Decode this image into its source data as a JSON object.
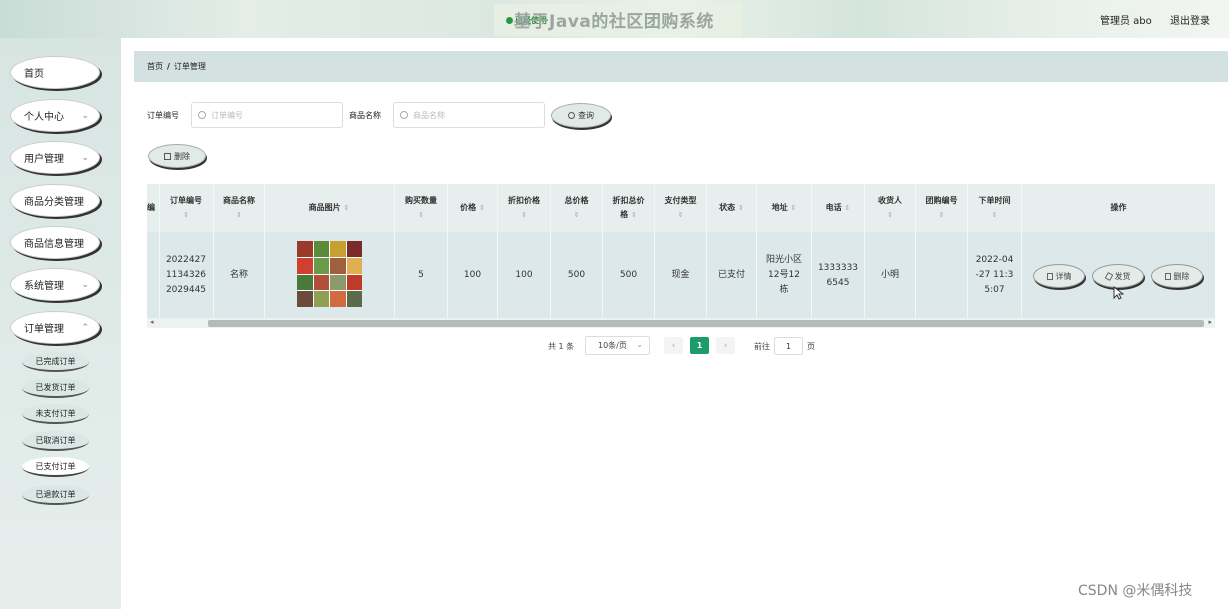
{
  "header": {
    "badge": "已经使用",
    "title": "基于Java的社区团购系统",
    "user": "管理员 abo",
    "logout": "退出登录"
  },
  "sidebar": {
    "items": [
      {
        "label": "首页",
        "chevron": false
      },
      {
        "label": "个人中心",
        "chevron": true
      },
      {
        "label": "用户管理",
        "chevron": true
      },
      {
        "label": "商品分类管理",
        "chevron": false
      },
      {
        "label": "商品信息管理",
        "chevron": false
      },
      {
        "label": "系统管理",
        "chevron": true
      },
      {
        "label": "订单管理",
        "chevron": true
      }
    ],
    "subitems": [
      "已完成订单",
      "已发货订单",
      "未支付订单",
      "已取消订单",
      "已支付订单",
      "已退款订单"
    ],
    "active_subitem": "已支付订单"
  },
  "breadcrumb": {
    "home": "首页",
    "separator": "/",
    "current": "订单管理"
  },
  "search": {
    "order_no_label": "订单编号",
    "order_no_placeholder": "订单编号",
    "product_name_label": "商品名称",
    "product_name_placeholder": "商品名称",
    "query_button": "查询",
    "delete_button": "删除"
  },
  "table": {
    "headers": {
      "cut": "编",
      "order_no": "订单编号",
      "product_name": "商品名称",
      "product_image": "商品图片",
      "quantity": "购买数量",
      "price": "价格",
      "discount_price": "折扣价格",
      "total_price": "总价格",
      "discount_total_line1": "折扣总价",
      "discount_total_line2": "格",
      "payment_type": "支付类型",
      "status": "状态",
      "address": "地址",
      "phone": "电话",
      "receiver": "收货人",
      "group_no": "团购编号",
      "order_time": "下单时间",
      "actions": "操作"
    },
    "sort_glyph": "⇕",
    "row": {
      "order_no_lines": [
        "2022427",
        "1134326",
        "2029445"
      ],
      "product_name": "名称",
      "quantity": "5",
      "price": "100",
      "discount_price": "100",
      "total_price": "500",
      "discount_total": "500",
      "payment_type": "现金",
      "status": "已支付",
      "address_lines": [
        "阳光小区",
        "12号12",
        "栋"
      ],
      "phone_lines": [
        "1333333",
        "6545"
      ],
      "receiver": "小明",
      "group_no": "",
      "order_time_lines": [
        "2022-04",
        "-27 11:3",
        "5:07"
      ],
      "btn_detail": "详情",
      "btn_ship": "发货",
      "btn_delete": "删除"
    }
  },
  "pagination": {
    "total": "共 1 条",
    "page_size": "10条/页",
    "prev": "‹",
    "current_page": "1",
    "next": "›",
    "goto_label": "前往",
    "goto_value": "1",
    "page_suffix": "页"
  },
  "watermark": "CSDN @米偶科技",
  "colors": {
    "accent": "#1d9b6b",
    "breadcrumb_bg": "#d3e2e1",
    "row_bg": "#dce8ea"
  }
}
